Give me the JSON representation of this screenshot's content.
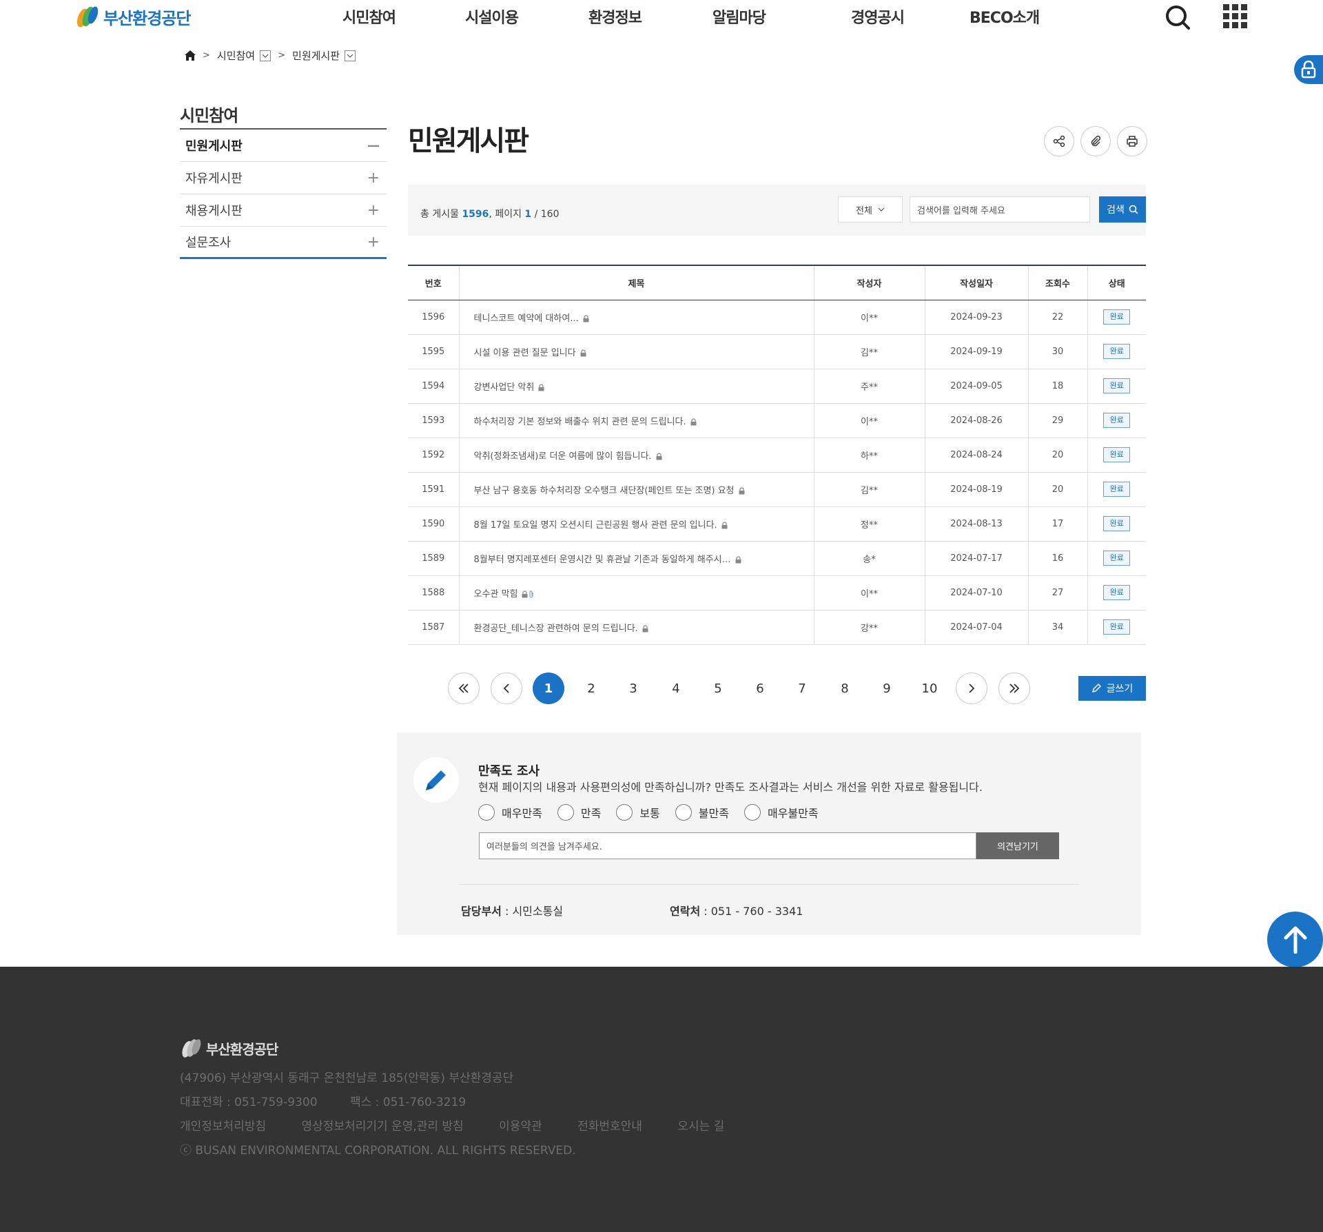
{
  "header": {
    "logo_text": "부산환경공단",
    "nav": [
      "시민참여",
      "시설이용",
      "환경정보",
      "알림마당",
      "경영공시",
      "BECO소개"
    ]
  },
  "breadcrumb": {
    "level1": "시민참여",
    "level2": "민원게시판"
  },
  "lnb": {
    "title": "시민참여",
    "items": [
      {
        "label": "민원게시판",
        "state": "—"
      },
      {
        "label": "자유게시판",
        "state": "+"
      },
      {
        "label": "채용게시판",
        "state": "+"
      },
      {
        "label": "설문조사",
        "state": "+"
      }
    ]
  },
  "page": {
    "title": "민원게시판"
  },
  "search": {
    "total_label": "총 게시물",
    "total": "1596",
    "page_label": "페이지",
    "current_page": "1",
    "total_pages": "/ 160",
    "select_value": "전체",
    "placeholder": "검색어를 입력해 주세요",
    "button": "검색"
  },
  "table": {
    "headers": [
      "번호",
      "제목",
      "작성자",
      "작성일자",
      "조회수",
      "상태"
    ],
    "rows": [
      {
        "no": "1596",
        "title": "테니스코트 예약에 대하여...",
        "writer": "이**",
        "date": "2024-09-23",
        "views": "22",
        "status": "완료",
        "attach": false
      },
      {
        "no": "1595",
        "title": "시설 이용 관련 질문 입니다",
        "writer": "김**",
        "date": "2024-09-19",
        "views": "30",
        "status": "완료",
        "attach": false
      },
      {
        "no": "1594",
        "title": "강변사업단 악취",
        "writer": "주**",
        "date": "2024-09-05",
        "views": "18",
        "status": "완료",
        "attach": false
      },
      {
        "no": "1593",
        "title": "하수처리장 기본 정보와 배출수 위치 관련 문의 드립니다.",
        "writer": "이**",
        "date": "2024-08-26",
        "views": "29",
        "status": "완료",
        "attach": false
      },
      {
        "no": "1592",
        "title": "악취(정화조냄새)로 더운 여름에 많이 힘듭니다.",
        "writer": "하**",
        "date": "2024-08-24",
        "views": "20",
        "status": "완료",
        "attach": false
      },
      {
        "no": "1591",
        "title": "부산 남구 용호동 하수처리장 오수탱크 새단장(페인트 또는 조명) 요청",
        "writer": "김**",
        "date": "2024-08-19",
        "views": "20",
        "status": "완료",
        "attach": false
      },
      {
        "no": "1590",
        "title": "8월 17일 토요일 명지 오션시티 근린공원 행사 관련 문의 입니다.",
        "writer": "정**",
        "date": "2024-08-13",
        "views": "17",
        "status": "완료",
        "attach": false
      },
      {
        "no": "1589",
        "title": "8월부터 명지레포센터 운영시간 및 휴관날 기존과 동일하게 해주시…",
        "writer": "송*",
        "date": "2024-07-17",
        "views": "16",
        "status": "완료",
        "attach": false
      },
      {
        "no": "1588",
        "title": "오수관 막힘",
        "writer": "이**",
        "date": "2024-07-10",
        "views": "27",
        "status": "완료",
        "attach": true
      },
      {
        "no": "1587",
        "title": "환경공단_테니스장 관련하여 문의 드립니다.",
        "writer": "강**",
        "date": "2024-07-04",
        "views": "34",
        "status": "완료",
        "attach": false
      }
    ]
  },
  "pagination": {
    "pages": [
      "1",
      "2",
      "3",
      "4",
      "5",
      "6",
      "7",
      "8",
      "9",
      "10"
    ],
    "current": "1"
  },
  "write_button": "글쓰기",
  "survey": {
    "title": "만족도 조사",
    "desc": "현재 페이지의 내용과 사용편의성에 만족하십니까? 만족도 조사결과는 서비스 개선을 위한 자료로 활용됩니다.",
    "options": [
      "매우만족",
      "만족",
      "보통",
      "불만족",
      "매우불만족"
    ],
    "opinion_placeholder": "여러분들의 의견을 남겨주세요.",
    "submit": "의견남기기",
    "dept_label": "담당부서",
    "dept": ": 시민소통실",
    "contact_label": "연락처",
    "contact": ": 051 - 760 - 3341"
  },
  "footer": {
    "logo_text": "부산환경공단",
    "address": "(47906) 부산광역시 동래구 온천천남로 185(안락동) 부산환경공단",
    "tel": "대표전화 : 051-759-9300",
    "fax": "팩스 : 051-760-3219",
    "links": [
      "개인정보처리방침",
      "영상정보처리기기 운영,관리 방침",
      "이용약관",
      "전화번호안내",
      "오시는 길"
    ],
    "copyright": "ⓒ BUSAN ENVIRONMENTAL CORPORATION. ALL RIGHTS RESERVED."
  },
  "colors": {
    "accent": "#1a73c5",
    "footer_bg": "#333333"
  }
}
